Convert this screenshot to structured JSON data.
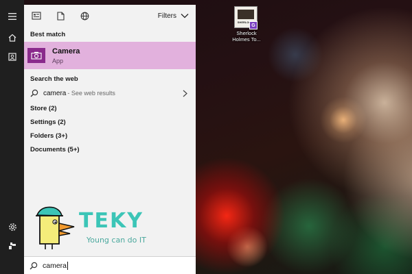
{
  "panel": {
    "filters_label": "Filters",
    "best_match_label": "Best match",
    "best_match": {
      "title": "Camera",
      "subtitle": "App"
    },
    "search_web_label": "Search the web",
    "web_result": {
      "query": "camera",
      "hint": "- See web results"
    },
    "categories": [
      {
        "label": "Store (2)"
      },
      {
        "label": "Settings (2)"
      },
      {
        "label": "Folders (3+)"
      },
      {
        "label": "Documents (5+)"
      }
    ],
    "search_value": "camera"
  },
  "logo": {
    "word": "TEKY",
    "tagline": "Young can do IT"
  },
  "desktop_icon": {
    "label_line1": "Sherlock",
    "label_line2": "Holmes To...",
    "thumb_text": "SHERLOCK",
    "badge_text": "G"
  },
  "colors": {
    "accent_highlight": "#e2b1dd",
    "app_tile": "#8a2a8c",
    "logo_teal": "#3cc5b7",
    "logo_yellow": "#f4ec7a"
  }
}
